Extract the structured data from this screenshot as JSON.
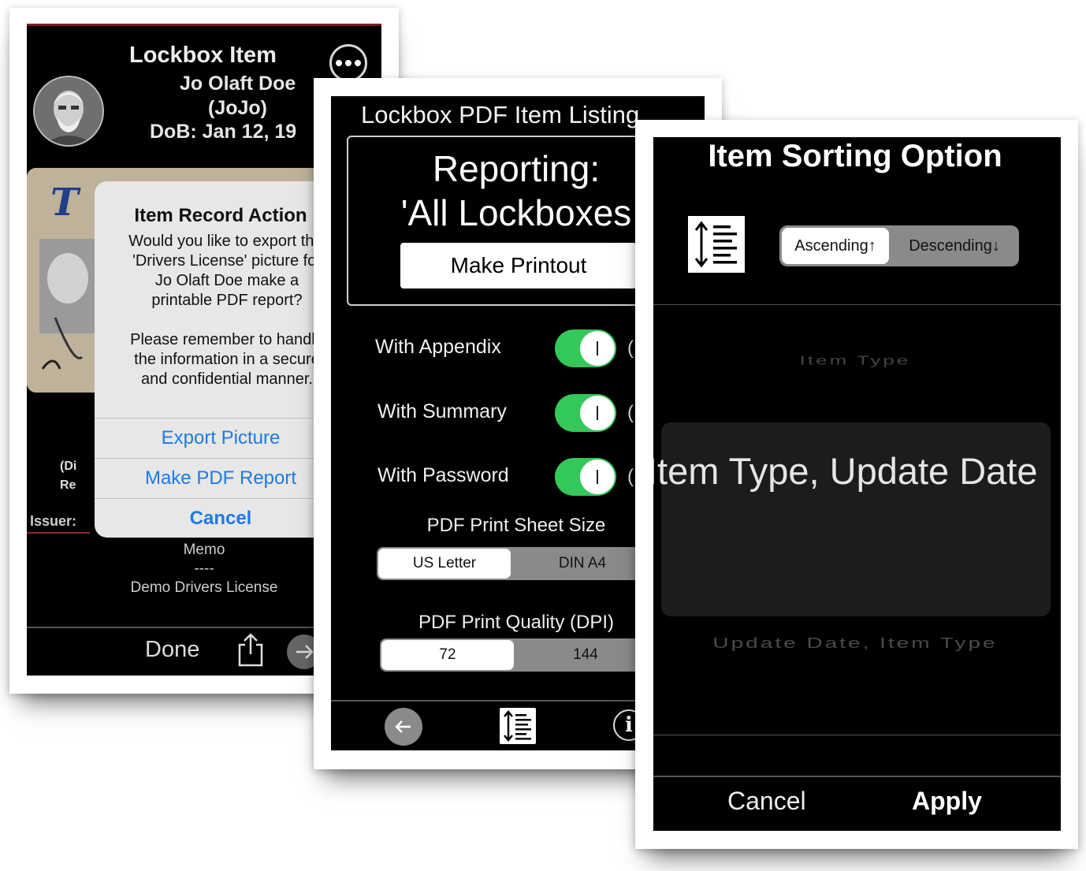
{
  "screen1": {
    "title": "Lockbox Item",
    "name_line1": "Jo Olaft Doe",
    "name_line2": "(JoJo)",
    "dob": "DoB: Jan 12, 19",
    "left_info_line1": "(Di",
    "left_info_line2": "Re",
    "issuer_label": "Issuer:",
    "memo_label": "Memo",
    "memo_divider": "----",
    "memo_text": "Demo Drivers License",
    "done_label": "Done",
    "action_sheet": {
      "title": "Item Record Action",
      "message": "Would you like to export this\n'Drivers License' picture for\nJo Olaft Doe  make a\nprintable PDF report?\n\nPlease remember to handle\nthe information in a secure\nand confidential manner.",
      "export_label": "Export Picture",
      "pdf_label": "Make PDF Report",
      "cancel_label": "Cancel"
    }
  },
  "screen2": {
    "title": "Lockbox PDF Item Listing",
    "reporting_line1": "Reporting:",
    "reporting_line2": "'All Lockboxes",
    "make_printout_label": "Make Printout",
    "toggles": [
      {
        "label": "With Appendix",
        "on": true
      },
      {
        "label": "With Summary",
        "on": true
      },
      {
        "label": "With Password",
        "on": true
      }
    ],
    "paren": "(",
    "sheet_size_title": "PDF Print Sheet Size",
    "sheet_size_options": [
      "US Letter",
      "DIN A4"
    ],
    "sheet_size_selected": "US Letter",
    "quality_title": "PDF Print Quality (DPI)",
    "quality_options": [
      "72",
      "144"
    ],
    "quality_selected": "72",
    "info_glyph": "i"
  },
  "screen3": {
    "title": "Item Sorting Option",
    "order_options": [
      "Ascending↑",
      "Descending↓"
    ],
    "order_selected": "Ascending↑",
    "picker_above": "Item Type",
    "picker_selected": "Item Type, Update Date",
    "picker_below": "Update Date, Item Type",
    "cancel_label": "Cancel",
    "apply_label": "Apply"
  },
  "colors": {
    "toggle_on": "#34c759",
    "ios_blue": "#1f7ae0",
    "screen_bg": "#000000"
  },
  "icons": [
    "more-icon",
    "share-icon",
    "next-arrow-icon",
    "back-arrow-icon",
    "sort-icon",
    "info-icon"
  ]
}
